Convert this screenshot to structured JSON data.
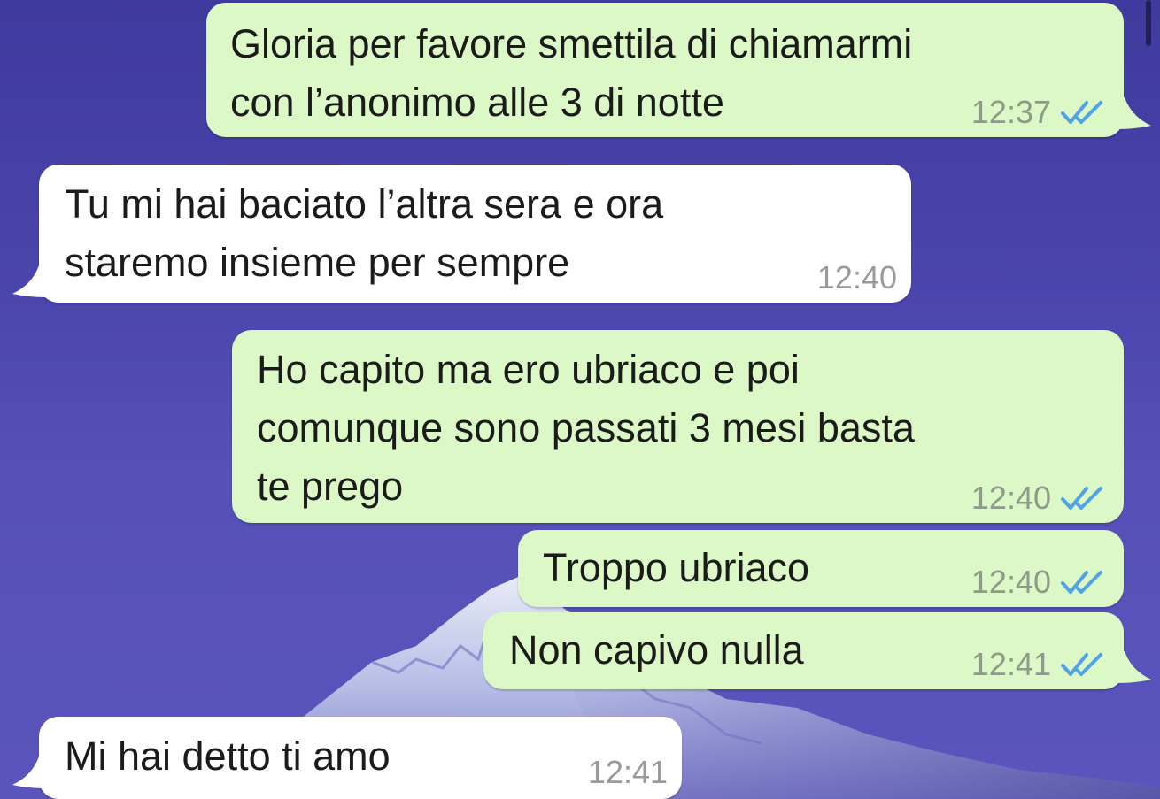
{
  "theme": {
    "outgoing_bubble": "#dcf8c6",
    "incoming_bubble": "#ffffff",
    "read_ticks": "#4fa3e6",
    "wallpaper": "#4a44ad"
  },
  "messages": [
    {
      "direction": "outgoing",
      "lines": [
        "Gloria per favore smettila di chiamarmi",
        "con l’anonimo alle 3 di notte"
      ],
      "time": "12:37",
      "status": "read"
    },
    {
      "direction": "incoming",
      "lines": [
        "Tu mi hai baciato l’altra sera e ora",
        "staremo insieme per sempre"
      ],
      "time": "12:40"
    },
    {
      "direction": "outgoing",
      "lines": [
        "Ho capito ma ero ubriaco e poi",
        "comunque sono passati 3 mesi basta",
        "te prego"
      ],
      "time": "12:40",
      "status": "read"
    },
    {
      "direction": "outgoing",
      "lines": [
        "Troppo ubriaco"
      ],
      "time": "12:40",
      "status": "read"
    },
    {
      "direction": "outgoing",
      "lines": [
        "Non capivo nulla"
      ],
      "time": "12:41",
      "status": "read"
    },
    {
      "direction": "incoming",
      "lines": [
        "Mi hai detto ti amo"
      ],
      "time": "12:41"
    }
  ]
}
